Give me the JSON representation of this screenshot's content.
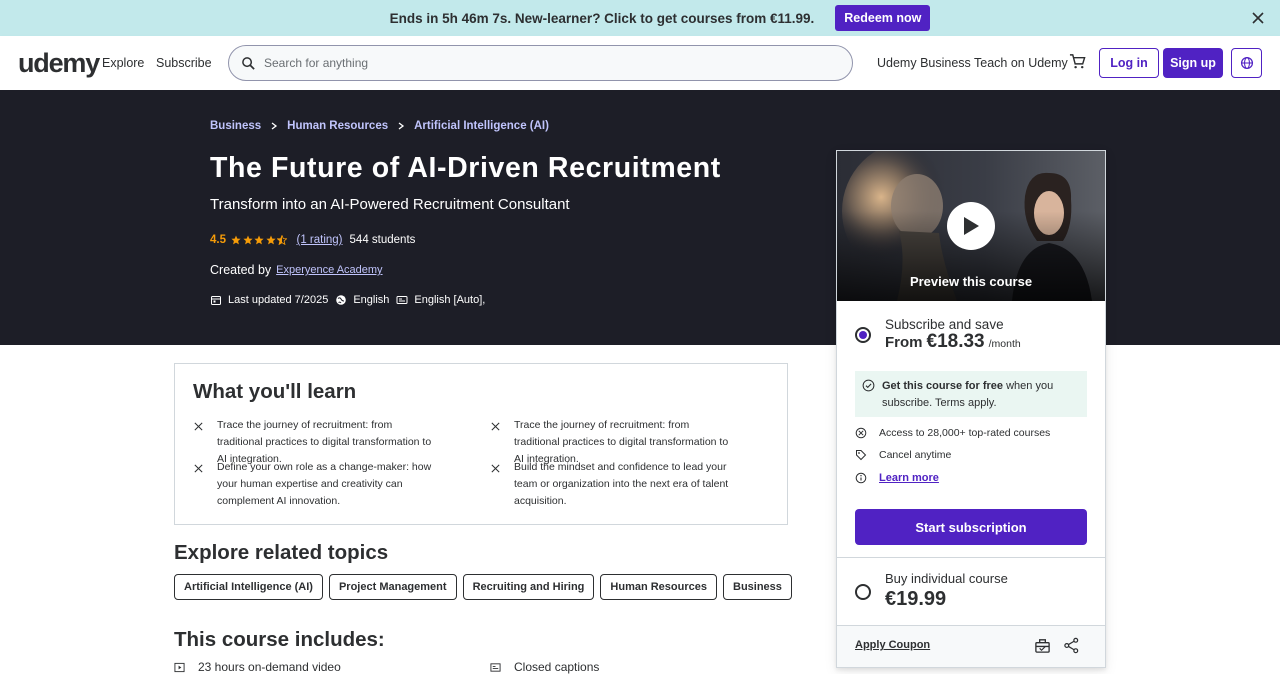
{
  "promo": {
    "text": "Ends in 5h 46m 7s. New-learner? Click to get courses from €11.99.",
    "button": "Redeem now"
  },
  "header": {
    "logo": "udemy",
    "explore": "Explore",
    "subscribe": "Subscribe",
    "search_placeholder": "Search for anything",
    "business": "Udemy Business",
    "teach": "Teach on Udemy",
    "login": "Log in",
    "signup": "Sign up"
  },
  "course": {
    "breadcrumb": [
      "Business",
      "Human Resources",
      "Artificial Intelligence (AI)"
    ],
    "title": "The Future of AI-Driven Recruitment",
    "subtitle": "Transform into an AI-Powered Recruitment Consultant",
    "rating": "4.5",
    "rating_value": 4.5,
    "rating_count": "(1 rating)",
    "students": "544 students",
    "created_by_label": "Created by",
    "creator": "Experyence Academy",
    "last_updated": "Last updated 7/2025",
    "language": "English",
    "captions": "English [Auto],"
  },
  "card": {
    "preview_label": "Preview this course",
    "subscribe_label": "Subscribe and save",
    "from": "From",
    "sub_price": "€18.33",
    "period": "/month",
    "free_strong": "Get this course for free",
    "free_rest": " when you subscribe. Terms apply.",
    "perks": [
      "Access to 28,000+ top-rated courses",
      "Cancel anytime"
    ],
    "learn_more": "Learn more",
    "start_button": "Start subscription",
    "individual_label": "Buy individual course",
    "individual_price": "€19.99",
    "apply_coupon": "Apply Coupon"
  },
  "learn": {
    "title": "What you'll learn",
    "items": [
      "Trace the journey of recruitment: from traditional practices to digital transformation to AI integration.",
      "Trace the journey of recruitment: from traditional practices to digital transformation to AI integration.",
      "Define your own role as a change-maker: how your human expertise and creativity can complement AI innovation.",
      "Build the mindset and confidence to lead your team or organization into the next era of talent acquisition."
    ]
  },
  "related": {
    "title": "Explore related topics",
    "topics": [
      "Artificial Intelligence (AI)",
      "Project Management",
      "Recruiting and Hiring",
      "Human Resources",
      "Business"
    ]
  },
  "includes": {
    "title": "This course includes:",
    "items": [
      "23 hours on-demand video",
      "Closed captions"
    ]
  }
}
